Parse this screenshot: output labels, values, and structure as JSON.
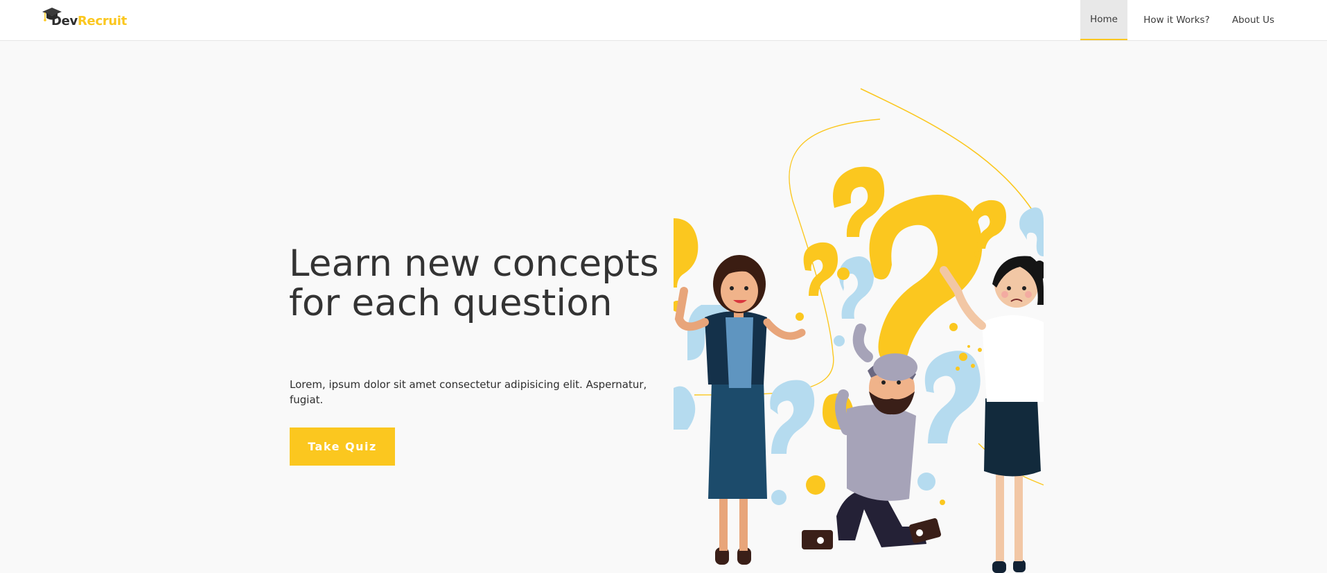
{
  "header": {
    "brand": {
      "part1": "Dev",
      "part2": "Recruit",
      "icon": "graduation-cap-icon"
    },
    "nav": [
      {
        "label": "Home",
        "active": true
      },
      {
        "label": "How it Works?",
        "active": false
      },
      {
        "label": "About Us",
        "active": false
      }
    ]
  },
  "hero": {
    "title": "Learn new concepts for each question",
    "description": "Lorem, ipsum dolor sit amet consectetur adipisicing elit. Aspernatur, fugiat.",
    "cta_label": "Take Quiz"
  },
  "colors": {
    "accent": "#fbc71f",
    "text": "#333333",
    "question_light": "#b5dbef",
    "background": "#f9f9f9"
  }
}
